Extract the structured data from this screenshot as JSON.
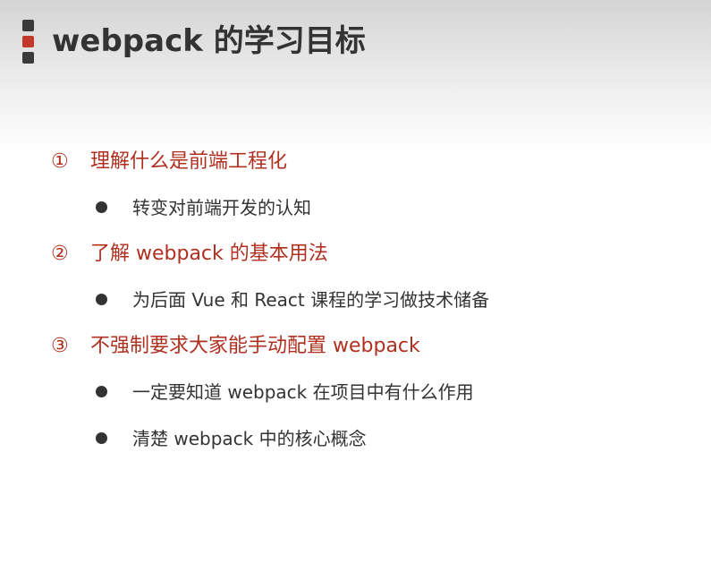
{
  "slide": {
    "title": "webpack 的学习目标",
    "goals": [
      {
        "num": "①",
        "text": "理解什么是前端工程化",
        "subs": [
          "转变对前端开发的认知"
        ]
      },
      {
        "num": "②",
        "text": "了解 webpack 的基本用法",
        "subs": [
          "为后面 Vue 和 React 课程的学习做技术储备"
        ]
      },
      {
        "num": "③",
        "text": "不强制要求大家能手动配置 webpack",
        "subs": [
          "一定要知道 webpack 在项目中有什么作用",
          "清楚 webpack 中的核心概念"
        ]
      }
    ]
  },
  "colors": {
    "accent": "#b03020",
    "marker_red": "#c0392b",
    "text_dark": "#333333"
  }
}
